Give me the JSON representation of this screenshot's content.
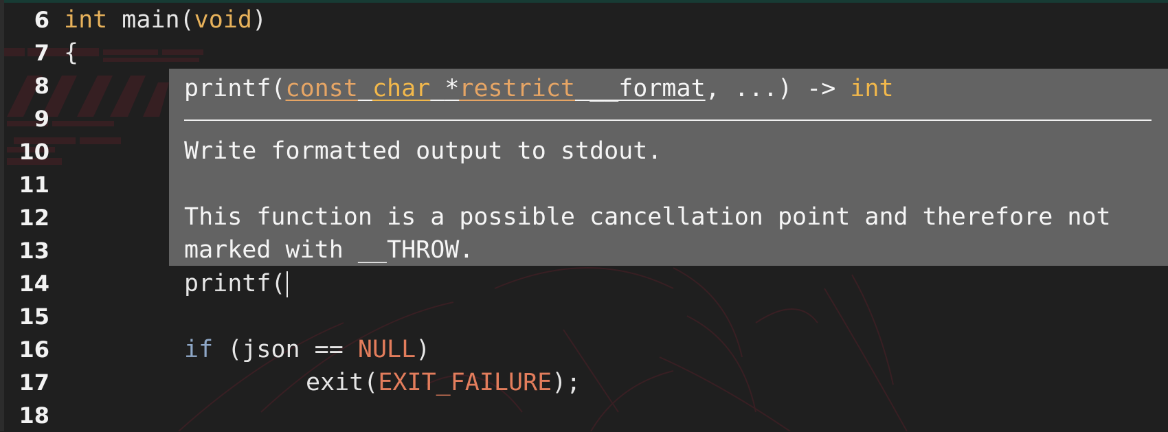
{
  "gutter": {
    "line_numbers": [
      "6",
      "7",
      "8",
      "9",
      "10",
      "11",
      "12",
      "13",
      "14",
      "15",
      "16",
      "17",
      "18"
    ]
  },
  "code": {
    "line6": {
      "type": "int",
      "func": "main",
      "lparen": "(",
      "param": "void",
      "rparen": ")"
    },
    "line7": {
      "text": "{"
    },
    "line14": {
      "text": "printf("
    },
    "line16": {
      "kw": "if",
      "open": " (json == ",
      "const": "NULL",
      "close": ")"
    },
    "line17": {
      "func": "exit(",
      "const": "EXIT_FAILURE",
      "tail": ");"
    }
  },
  "hover": {
    "signature": {
      "name": "printf(",
      "qualifier": "const",
      "space1": " ",
      "type": "char",
      "space2": " ",
      "star": "*",
      "restrict": "restrict",
      "space3": " ",
      "param": "__format",
      "rest": ", ...) -> ",
      "return_type": "int"
    },
    "summary": "Write formatted output to stdout.",
    "detail_line1": "This function is a possible cancellation point and therefore not",
    "detail_line2": "marked with __THROW."
  },
  "colors": {
    "background": "#1f1f1f",
    "hover_background": "#636363",
    "type": "#e8b25b",
    "keyword": "#8fa8c8",
    "constant": "#e37d5c"
  }
}
